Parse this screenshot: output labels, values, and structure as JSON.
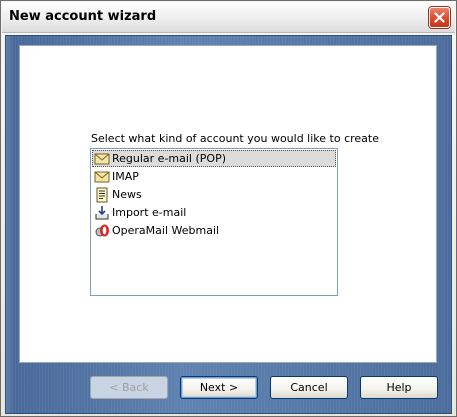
{
  "window": {
    "title": "New account wizard"
  },
  "prompt": "Select what kind of account you would like to create",
  "account_types": [
    {
      "label": "Regular e-mail (POP)",
      "icon": "envelope-icon",
      "selected": true
    },
    {
      "label": "IMAP",
      "icon": "envelope-icon",
      "selected": false
    },
    {
      "label": "News",
      "icon": "news-icon",
      "selected": false
    },
    {
      "label": "Import e-mail",
      "icon": "import-icon",
      "selected": false
    },
    {
      "label": "OperaMail Webmail",
      "icon": "opera-icon",
      "selected": false
    }
  ],
  "buttons": {
    "back": "< Back",
    "next": "Next >",
    "cancel": "Cancel",
    "help": "Help"
  },
  "colors": {
    "frame": "#4c6d9c",
    "close": "#d94c2b",
    "selection": "#dcdcdc"
  }
}
